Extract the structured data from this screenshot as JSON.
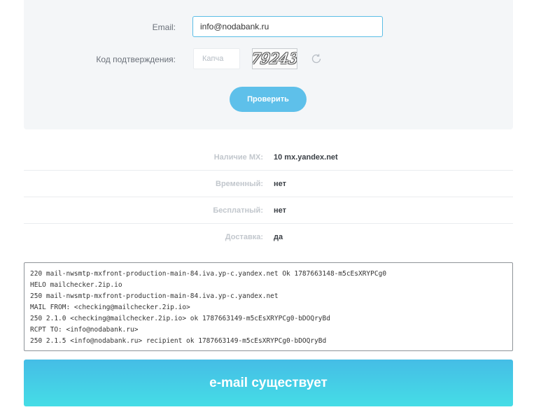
{
  "form": {
    "email_label": "Email:",
    "email_value": "info@nodabank.ru",
    "captcha_label": "Код подтверждения:",
    "captcha_placeholder": "Капча",
    "captcha_text": "79243",
    "refresh_icon": "refresh-icon",
    "check_button": "Проверить"
  },
  "results": [
    {
      "key": "Наличие MX:",
      "value": "10 mx.yandex.net"
    },
    {
      "key": "Временный:",
      "value": "нет"
    },
    {
      "key": "Бесплатный:",
      "value": "нет"
    },
    {
      "key": "Доставка:",
      "value": "да"
    }
  ],
  "log": [
    "220 mail-nwsmtp-mxfront-production-main-84.iva.yp-c.yandex.net Ok 1787663148-m5cEsXRYPCg0",
    "HELO mailchecker.2ip.io",
    "250 mail-nwsmtp-mxfront-production-main-84.iva.yp-c.yandex.net",
    "MAIL FROM: <checking@mailchecker.2ip.io>",
    "250 2.1.0 <checking@mailchecker.2ip.io> ok 1787663149-m5cEsXRYPCg0-bDOQryBd",
    "RCPT TO: <info@nodabank.ru>",
    "250 2.1.5 <info@nodabank.ru> recipient ok 1787663149-m5cEsXRYPCg0-bDOQryBd"
  ],
  "banner": "e-mail существует",
  "colors": {
    "accent": "#5ec0ea",
    "banner_start": "#45bde6",
    "banner_end": "#45dde6",
    "panel_bg": "#f4f6f8"
  }
}
